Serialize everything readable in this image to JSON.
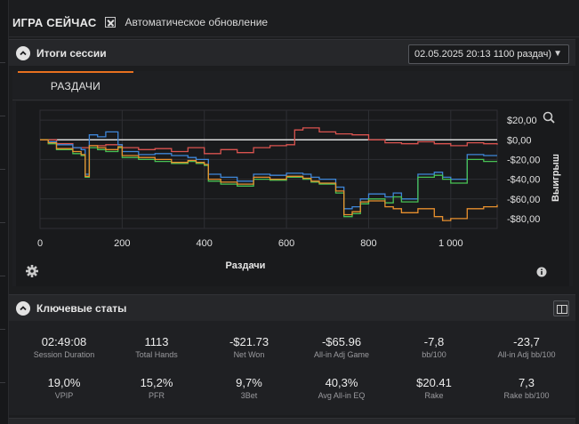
{
  "header": {
    "title": "ИГРА СЕЙЧАС",
    "auto_update_label": "Автоматическое обновление",
    "auto_update_checked": true
  },
  "session_results": {
    "title": "Итоги сессии",
    "session_select_value": "02.05.2025 20:13 1100 раздач)",
    "tabs": [
      {
        "label": "РАЗДАЧИ",
        "active": true
      }
    ]
  },
  "chart_data": {
    "type": "line",
    "xlabel": "Раздачи",
    "ylabel": "Выигрыш",
    "xlim": [
      0,
      1113
    ],
    "ylim": [
      -90,
      30
    ],
    "x_ticks": [
      0,
      200,
      400,
      600,
      800,
      1000
    ],
    "x_tick_labels": [
      "0",
      "200",
      "400",
      "600",
      "800",
      "1 000"
    ],
    "y_ticks": [
      20,
      0,
      -20,
      -40,
      -60,
      -80
    ],
    "y_tick_labels": [
      "$20,00",
      "$0,00",
      "-$20,00",
      "-$40,00",
      "-$60,00",
      "-$80,00"
    ],
    "grid": true,
    "zero_line_color": "#ffffff",
    "series": [
      {
        "color": "#d9534f",
        "x": [
          0,
          40,
          80,
          120,
          160,
          200,
          240,
          280,
          320,
          360,
          400,
          440,
          480,
          520,
          560,
          600,
          620,
          640,
          680,
          720,
          760,
          800,
          840,
          880,
          920,
          960,
          1000,
          1040,
          1080,
          1113
        ],
        "y": [
          0,
          -4,
          -8,
          -6,
          -5,
          -8,
          -10,
          -9,
          -12,
          -8,
          -14,
          -10,
          -13,
          -8,
          -6,
          -5,
          10,
          12,
          8,
          6,
          5,
          0,
          -3,
          -4,
          -2,
          -4,
          -6,
          -3,
          -4,
          -5
        ]
      },
      {
        "color": "#3f86d8",
        "x": [
          0,
          20,
          40,
          80,
          100,
          110,
          120,
          140,
          160,
          190,
          200,
          240,
          280,
          320,
          360,
          380,
          400,
          410,
          440,
          480,
          520,
          560,
          600,
          640,
          660,
          680,
          720,
          740,
          760,
          780,
          800,
          840,
          860,
          880,
          920,
          960,
          980,
          1000,
          1040,
          1080,
          1113
        ],
        "y": [
          0,
          -2,
          -5,
          -8,
          -10,
          -35,
          5,
          3,
          8,
          -5,
          -12,
          -15,
          -14,
          -16,
          -18,
          -20,
          -20,
          -35,
          -38,
          -42,
          -35,
          -36,
          -34,
          -35,
          -38,
          -40,
          -48,
          -70,
          -68,
          -60,
          -55,
          -58,
          -54,
          -60,
          -35,
          -33,
          -38,
          -40,
          -15,
          -16,
          -16
        ]
      },
      {
        "color": "#48c254",
        "x": [
          0,
          20,
          40,
          80,
          100,
          110,
          120,
          140,
          160,
          190,
          200,
          240,
          280,
          320,
          360,
          380,
          400,
          410,
          440,
          480,
          520,
          560,
          600,
          640,
          660,
          680,
          720,
          740,
          760,
          780,
          800,
          840,
          860,
          880,
          920,
          960,
          980,
          1000,
          1040,
          1080,
          1113
        ],
        "y": [
          0,
          -4,
          -10,
          -14,
          -16,
          -38,
          -8,
          -10,
          -12,
          -8,
          -18,
          -20,
          -22,
          -24,
          -22,
          -24,
          -26,
          -42,
          -45,
          -47,
          -40,
          -41,
          -38,
          -40,
          -43,
          -45,
          -54,
          -78,
          -75,
          -65,
          -60,
          -64,
          -58,
          -63,
          -38,
          -36,
          -40,
          -44,
          -20,
          -22,
          -22
        ]
      },
      {
        "color": "#e8902e",
        "x": [
          0,
          20,
          40,
          80,
          100,
          110,
          120,
          140,
          160,
          190,
          200,
          240,
          280,
          320,
          360,
          380,
          400,
          410,
          440,
          480,
          520,
          560,
          600,
          640,
          660,
          680,
          720,
          740,
          760,
          780,
          800,
          840,
          860,
          880,
          920,
          960,
          980,
          1000,
          1040,
          1080,
          1113
        ],
        "y": [
          0,
          -3,
          -9,
          -12,
          -15,
          -37,
          -6,
          -8,
          -10,
          -7,
          -16,
          -18,
          -20,
          -23,
          -21,
          -23,
          -25,
          -40,
          -43,
          -45,
          -38,
          -40,
          -37,
          -39,
          -42,
          -44,
          -52,
          -76,
          -73,
          -63,
          -62,
          -68,
          -70,
          -74,
          -70,
          -78,
          -82,
          -80,
          -70,
          -68,
          -66
        ]
      }
    ]
  },
  "key_stats": {
    "title": "Ключевые статы",
    "rows": [
      [
        {
          "value": "02:49:08",
          "label": "Session Duration"
        },
        {
          "value": "1113",
          "label": "Total Hands"
        },
        {
          "value": "-$21.73",
          "label": "Net Won"
        },
        {
          "value": "-$65.96",
          "label": "All-in Adj Game"
        },
        {
          "value": "-7,8",
          "label": "bb/100"
        },
        {
          "value": "-23,7",
          "label": "All-in Adj bb/100"
        }
      ],
      [
        {
          "value": "19,0%",
          "label": "VPIP"
        },
        {
          "value": "15,2%",
          "label": "PFR"
        },
        {
          "value": "9,7%",
          "label": "3Bet"
        },
        {
          "value": "40,3%",
          "label": "Avg All-in EQ"
        },
        {
          "value": "$20.41",
          "label": "Rake"
        },
        {
          "value": "7,3",
          "label": "Rake bb/100"
        }
      ]
    ]
  }
}
